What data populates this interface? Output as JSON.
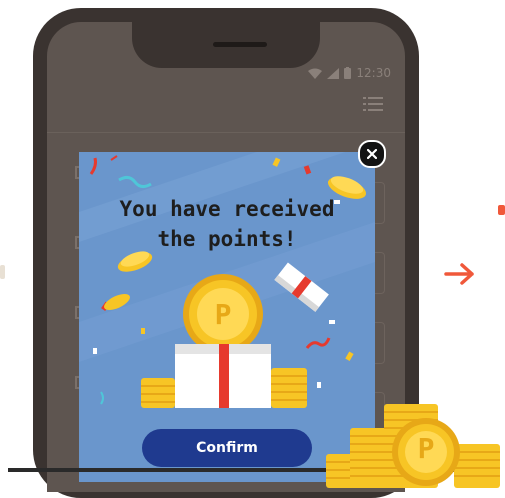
{
  "status_bar": {
    "time": "12:30"
  },
  "popup": {
    "title_line1": "You have received",
    "title_line2": "the points!",
    "coin_letter": "P",
    "confirm_label": "Confirm"
  },
  "colors": {
    "popup_bg": "#6a96cc",
    "confirm_bg": "#1f3a8f",
    "coin_gold": "#f7c525",
    "arrow": "#f0583a",
    "ribbon_red": "#e63a2e"
  }
}
